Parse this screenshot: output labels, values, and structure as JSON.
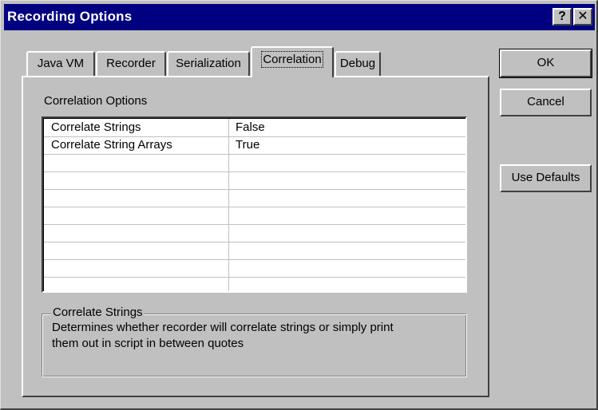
{
  "window": {
    "title": "Recording Options",
    "help_label": "?",
    "close_label": "✕"
  },
  "tabs": [
    {
      "label": "Java VM",
      "active": false
    },
    {
      "label": "Recorder",
      "active": false
    },
    {
      "label": "Serialization",
      "active": false
    },
    {
      "label": "Correlation",
      "active": true
    },
    {
      "label": "Debug",
      "active": false
    }
  ],
  "panel": {
    "section_label": "Correlation Options",
    "grid": {
      "rows": [
        {
          "name": "Correlate Strings",
          "value": "False"
        },
        {
          "name": "Correlate String Arrays",
          "value": "True"
        },
        {
          "name": "",
          "value": ""
        },
        {
          "name": "",
          "value": ""
        },
        {
          "name": "",
          "value": ""
        },
        {
          "name": "",
          "value": ""
        },
        {
          "name": "",
          "value": ""
        },
        {
          "name": "",
          "value": ""
        },
        {
          "name": "",
          "value": ""
        },
        {
          "name": "",
          "value": ""
        }
      ]
    },
    "description": {
      "title": "Correlate Strings",
      "text_line1": "Determines whether recorder will correlate strings or simply print",
      "text_line2": "them out in script in between quotes"
    }
  },
  "buttons": {
    "ok": "OK",
    "cancel": "Cancel",
    "use_defaults": "Use Defaults"
  }
}
